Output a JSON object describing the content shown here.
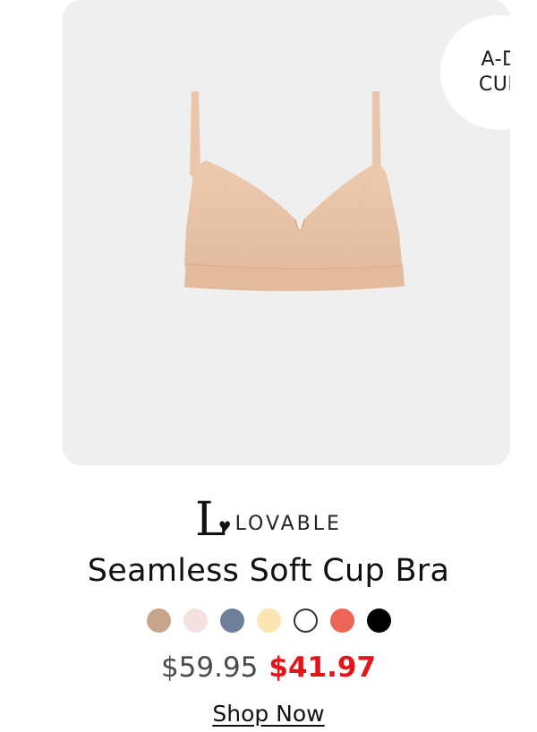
{
  "badge": {
    "line1": "A-D",
    "line2": "CUP"
  },
  "brand": {
    "name": "LOVABLE",
    "logo_letter": "L",
    "logo_heart": "♥"
  },
  "product": {
    "title": "Seamless Soft Cup Bra",
    "image_icon": "bra-product-image",
    "product_color": "#e8c4a8"
  },
  "swatches": [
    {
      "name": "beige",
      "color": "#c7a48a"
    },
    {
      "name": "light-pink",
      "color": "#f5e2e0"
    },
    {
      "name": "slate-blue",
      "color": "#6e7f99"
    },
    {
      "name": "pale-yellow",
      "color": "#fbe5b0"
    },
    {
      "name": "white",
      "color": "#ffffff"
    },
    {
      "name": "coral",
      "color": "#ec6657"
    },
    {
      "name": "black",
      "color": "#000000"
    }
  ],
  "price": {
    "original": "$59.95",
    "sale": "$41.97",
    "sale_color": "#e5141b"
  },
  "cta": {
    "label": "Shop Now"
  }
}
